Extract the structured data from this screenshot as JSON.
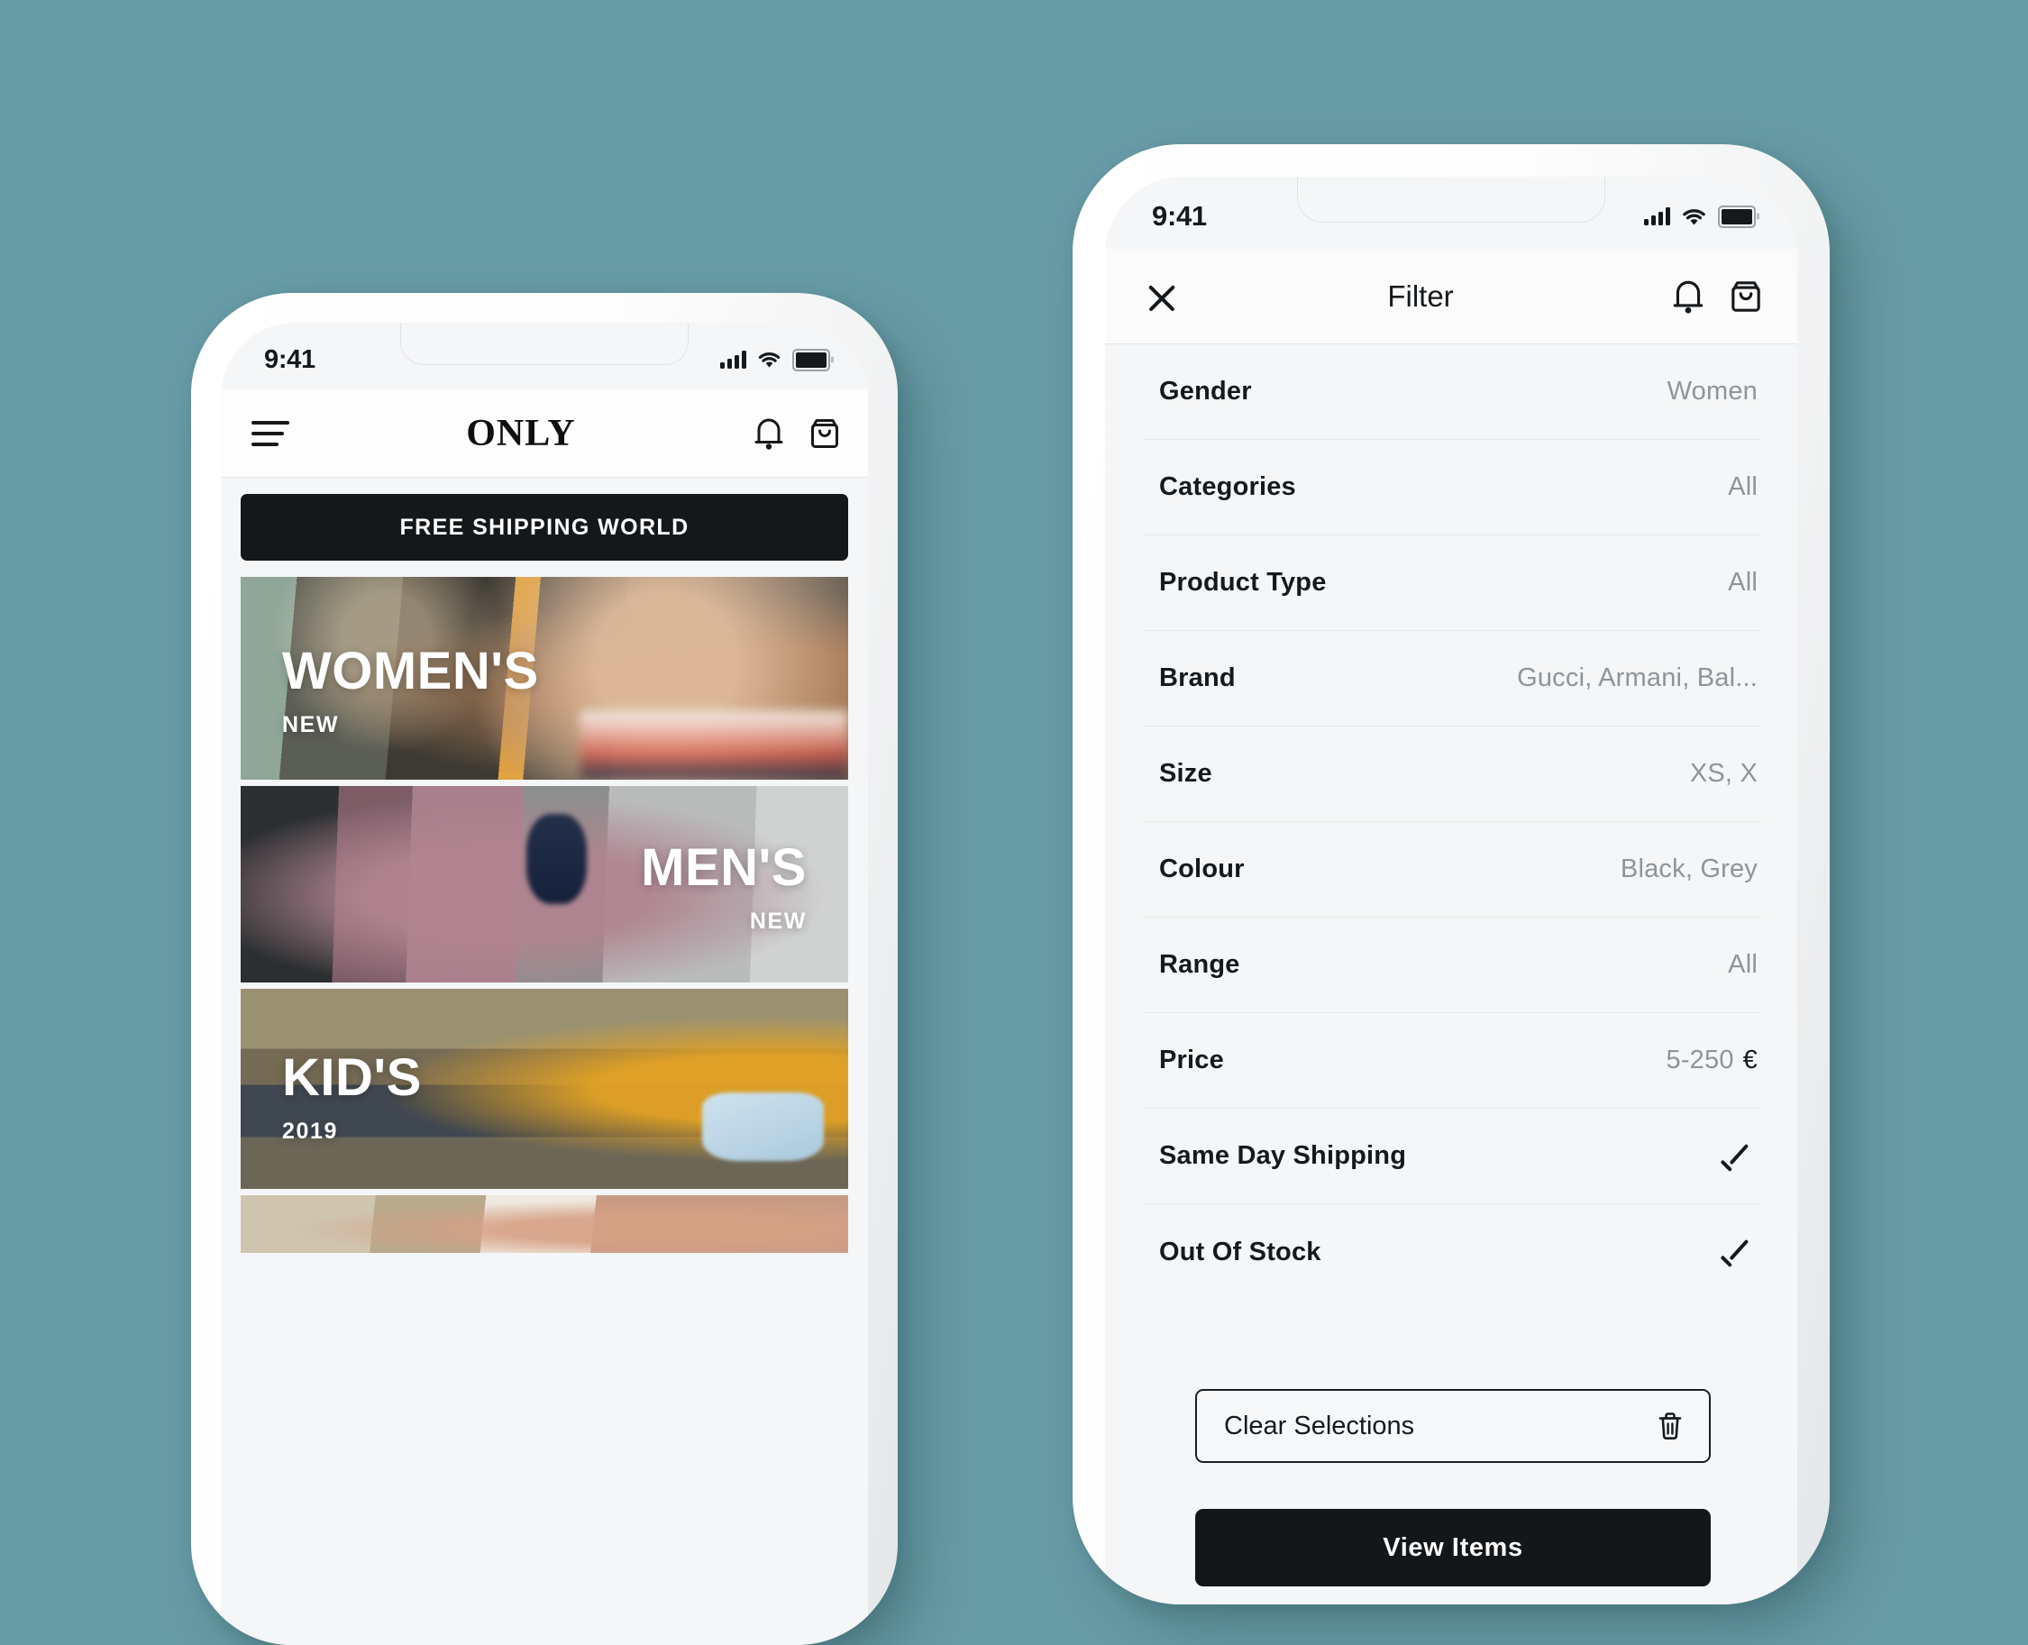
{
  "background_color": "#689ca6",
  "home_screen": {
    "status_bar": {
      "time": "9:41",
      "signal_icon": "signal-bars-icon",
      "wifi_icon": "wifi-icon",
      "battery_icon": "battery-full-icon"
    },
    "header": {
      "menu_icon": "hamburger-menu-icon",
      "brand": "ONLY",
      "bell_icon": "bell-icon",
      "bag_icon": "shopping-bag-icon"
    },
    "promo_banner": {
      "text": "FREE SHIPPING WORLD",
      "background": "#15181b"
    },
    "categories": [
      {
        "title": "WOMEN'S",
        "subtitle": "NEW",
        "align": "left"
      },
      {
        "title": "MEN'S",
        "subtitle": "NEW",
        "align": "right"
      },
      {
        "title": "KID'S",
        "subtitle": "2019",
        "align": "left"
      },
      {
        "title": "",
        "subtitle": "",
        "align": "left"
      }
    ]
  },
  "filter_screen": {
    "status_bar": {
      "time": "9:41",
      "signal_icon": "signal-bars-icon",
      "wifi_icon": "wifi-icon",
      "battery_icon": "battery-full-icon"
    },
    "header": {
      "close_icon": "close-icon",
      "title": "Filter",
      "bell_icon": "bell-icon",
      "bag_icon": "shopping-bag-icon"
    },
    "rows": [
      {
        "label": "Gender",
        "value": "Women",
        "type": "value"
      },
      {
        "label": "Categories",
        "value": "All",
        "type": "value"
      },
      {
        "label": "Product Type",
        "value": "All",
        "type": "value"
      },
      {
        "label": "Brand",
        "value": "Gucci, Armani, Bal...",
        "type": "value"
      },
      {
        "label": "Size",
        "value": "XS, X",
        "type": "value"
      },
      {
        "label": "Colour",
        "value": "Black, Grey",
        "type": "value"
      },
      {
        "label": "Range",
        "value": "All",
        "type": "value"
      },
      {
        "label": "Price",
        "value": "5-250",
        "currency": "€",
        "type": "price"
      },
      {
        "label": "Same Day Shipping",
        "value": "",
        "type": "check"
      },
      {
        "label": "Out Of Stock",
        "value": "",
        "type": "check"
      }
    ],
    "clear_button": {
      "label": "Clear Selections",
      "icon": "trash-icon"
    },
    "view_button": {
      "label": "View Items"
    }
  }
}
